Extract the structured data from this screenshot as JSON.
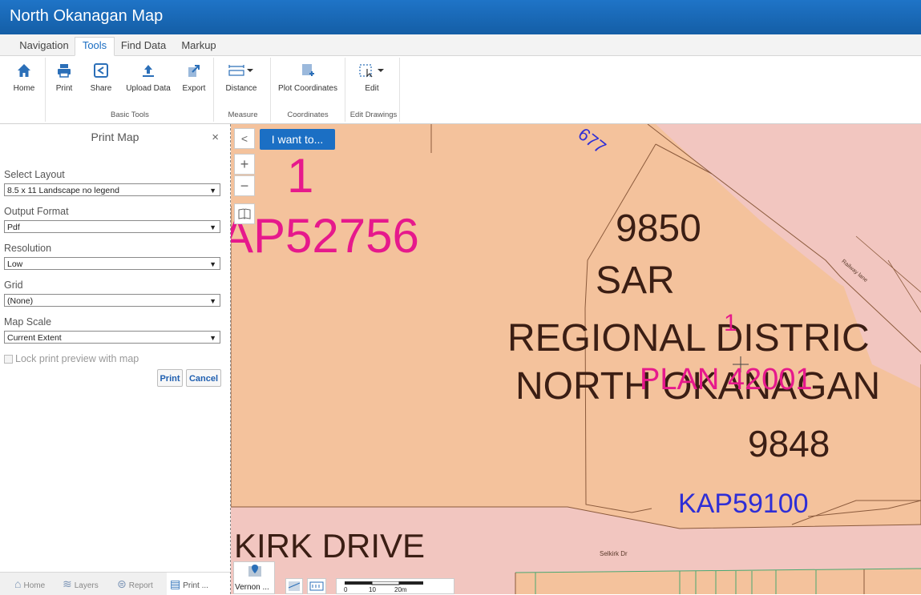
{
  "app": {
    "title": "North Okanagan Map"
  },
  "tabs": [
    {
      "label": "Navigation",
      "active": false
    },
    {
      "label": "Tools",
      "active": true
    },
    {
      "label": "Find Data",
      "active": false
    },
    {
      "label": "Markup",
      "active": false
    }
  ],
  "ribbon": {
    "home": "Home",
    "print": "Print",
    "share": "Share",
    "upload": "Upload Data",
    "export": "Export",
    "basic_tools": "Basic Tools",
    "distance": "Distance",
    "measure": "Measure",
    "plot_coordinates": "Plot Coordinates",
    "coordinates": "Coordinates",
    "edit": "Edit",
    "edit_drawings": "Edit Drawings"
  },
  "panel": {
    "title": "Print Map",
    "close": "×",
    "layout_label": "Select Layout",
    "layout_value": "8.5 x 11 Landscape no legend",
    "format_label": "Output Format",
    "format_value": "Pdf",
    "resolution_label": "Resolution",
    "resolution_value": "Low",
    "grid_label": "Grid",
    "grid_value": "(None)",
    "scale_label": "Map Scale",
    "scale_value": "Current Extent",
    "lock_label": "Lock print preview with map",
    "lock_checked": false,
    "print_btn": "Print",
    "cancel_btn": "Cancel"
  },
  "bottom_tabs": [
    {
      "label": "Home",
      "icon": "home-icon"
    },
    {
      "label": "Layers",
      "icon": "layers-icon"
    },
    {
      "label": "Report",
      "icon": "report-icon"
    },
    {
      "label": "Print ...",
      "icon": "print-icon"
    }
  ],
  "map": {
    "i_want_to": "I want to...",
    "collapse": "<",
    "zoom_in": "+",
    "zoom_out": "−",
    "labels": {
      "lot1_top": "1",
      "plan_kap": "AP52756",
      "num_677": "677",
      "num_9850": "9850",
      "sar": "SAR",
      "regional": "REGIONAL DISTRIC",
      "lot1_mid": "1",
      "plan_42001": "PLAN 42001",
      "north_okanagan": "NORTH OKANAGAN",
      "num_9848": "9848",
      "kap59100": "KAP59100",
      "kirk_drive": "KIRK DRIVE",
      "selkirk_dr": "Selkirk Dr",
      "railway": "Railway lane"
    },
    "locator_label": "Vernon ...",
    "scale_ticks": [
      "0",
      "10",
      "20m"
    ],
    "colors": {
      "parcel": "#f4c29c",
      "road": "#f2c6c0",
      "plan_magenta": "#e6198c",
      "plan_blue": "#2e2ed6"
    }
  }
}
